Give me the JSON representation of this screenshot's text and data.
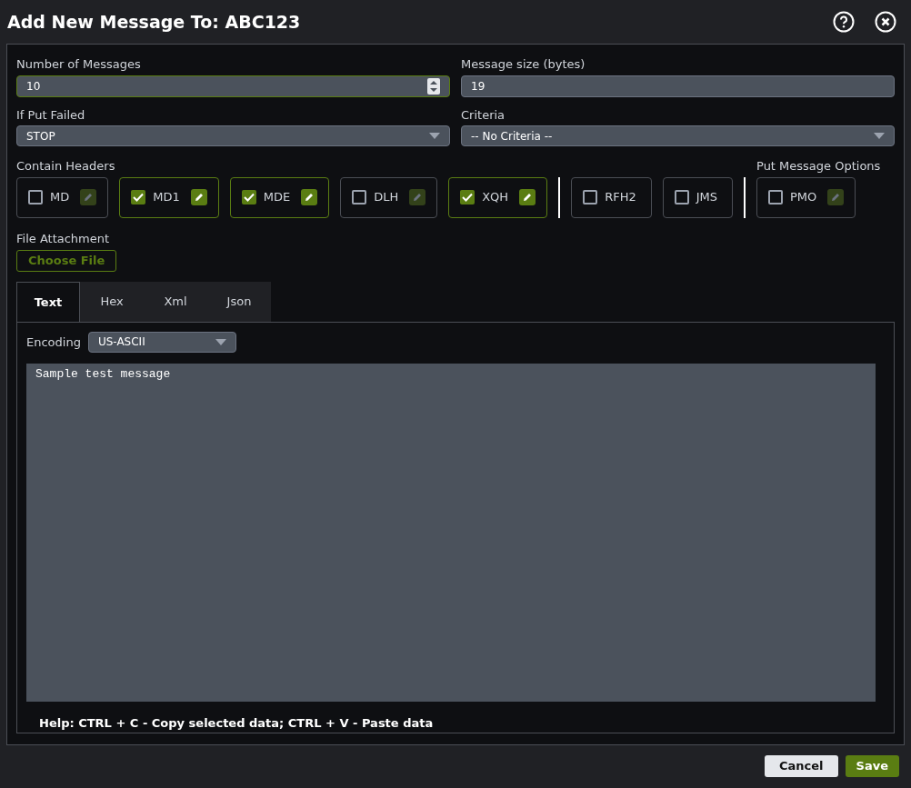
{
  "dialog": {
    "title": "Add New Message To: ABC123"
  },
  "fields": {
    "count": {
      "label": "Number of Messages",
      "value": "10"
    },
    "size": {
      "label": "Message size (bytes)",
      "value": "19"
    },
    "put_failed": {
      "label": "If Put Failed",
      "value": "STOP"
    },
    "criteria": {
      "label": "Criteria",
      "value": "-- No Criteria --"
    }
  },
  "headers": {
    "label": "Contain Headers",
    "groups": [
      [
        {
          "label": "MD",
          "checked": false,
          "editable": true
        },
        {
          "label": "MD1",
          "checked": true,
          "editable": true
        },
        {
          "label": "MDE",
          "checked": true,
          "editable": true
        },
        {
          "label": "DLH",
          "checked": false,
          "editable": true
        },
        {
          "label": "XQH",
          "checked": true,
          "editable": true
        }
      ],
      [
        {
          "label": "RFH2",
          "checked": false,
          "editable": false
        },
        {
          "label": "JMS",
          "checked": false,
          "editable": false
        }
      ]
    ]
  },
  "put_message_options": {
    "label": "Put Message Options",
    "items": [
      {
        "label": "PMO",
        "checked": false,
        "editable": true
      }
    ]
  },
  "attachment": {
    "label": "File Attachment",
    "button": "Choose File"
  },
  "tabs": [
    {
      "label": "Text",
      "selected": true
    },
    {
      "label": "Hex",
      "selected": false
    },
    {
      "label": "Xml",
      "selected": false
    },
    {
      "label": "Json",
      "selected": false
    }
  ],
  "encoding": {
    "label": "Encoding",
    "value": "US-ASCII"
  },
  "message": "Sample test message",
  "help": "Help: CTRL + C - Copy selected data; CTRL + V - Paste data",
  "buttons": {
    "cancel": "Cancel",
    "save": "Save"
  }
}
